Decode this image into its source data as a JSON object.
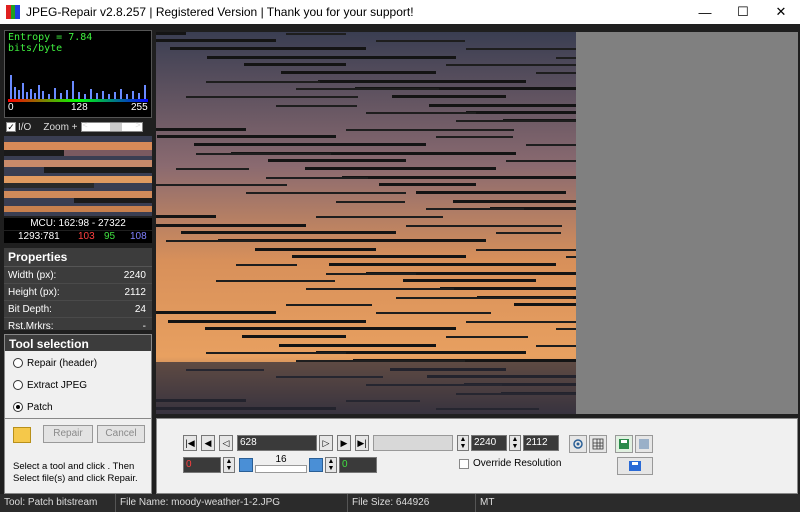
{
  "window": {
    "title": "JPEG-Repair v2.8.257 | Registered Version | Thank you for your support!",
    "controls": [
      "minimize",
      "maximize",
      "close"
    ]
  },
  "entropy": {
    "label": "Entropy = 7.84 bits/byte",
    "scale_min": "0",
    "scale_mid": "128",
    "scale_max": "255"
  },
  "zoom": {
    "io_label": "I/O",
    "io_checked": true,
    "label": "Zoom +",
    "left_arrow": "<",
    "right_arrow": ">"
  },
  "mcu": {
    "text": "MCU: 162:98 - 27322",
    "coords": "1293:781",
    "r": "103",
    "g": "95",
    "b": "108"
  },
  "properties": {
    "title": "Properties",
    "rows": [
      {
        "label": "Width (px):",
        "value": "2240"
      },
      {
        "label": "Height (px):",
        "value": "2112"
      },
      {
        "label": "Bit Depth:",
        "value": "24"
      },
      {
        "label": "Rst.Mrkrs:",
        "value": "-"
      }
    ]
  },
  "tool_selection": {
    "title": "Tool selection",
    "options": [
      {
        "label": "Repair (header)",
        "selected": false
      },
      {
        "label": "Extract JPEG",
        "selected": false
      },
      {
        "label": "Patch",
        "selected": true
      }
    ]
  },
  "actions": {
    "repair_label": "Repair",
    "cancel_label": "Cancel",
    "hint": "Select a tool and click . Then Select file(s) and click Repair."
  },
  "patch_controls": {
    "position_value": "628",
    "red_value": "0",
    "green_value": "0",
    "slider_value": "16",
    "width_value": "2240",
    "height_value": "2112",
    "override_label": "Override Resolution",
    "override_checked": false
  },
  "status": {
    "tool": "Tool: Patch bitstream",
    "file_name": "File Name: moody-weather-1-2.JPG",
    "file_size": "File Size: 644926",
    "mode": "MT"
  },
  "colors": {
    "entropy_text": "#3ff03f",
    "red_value": "#ff4040",
    "green_value": "#40e040",
    "blue_value": "#8080ff",
    "sky_dark": "#3a3e52",
    "sky_orange": "#e0905a"
  }
}
